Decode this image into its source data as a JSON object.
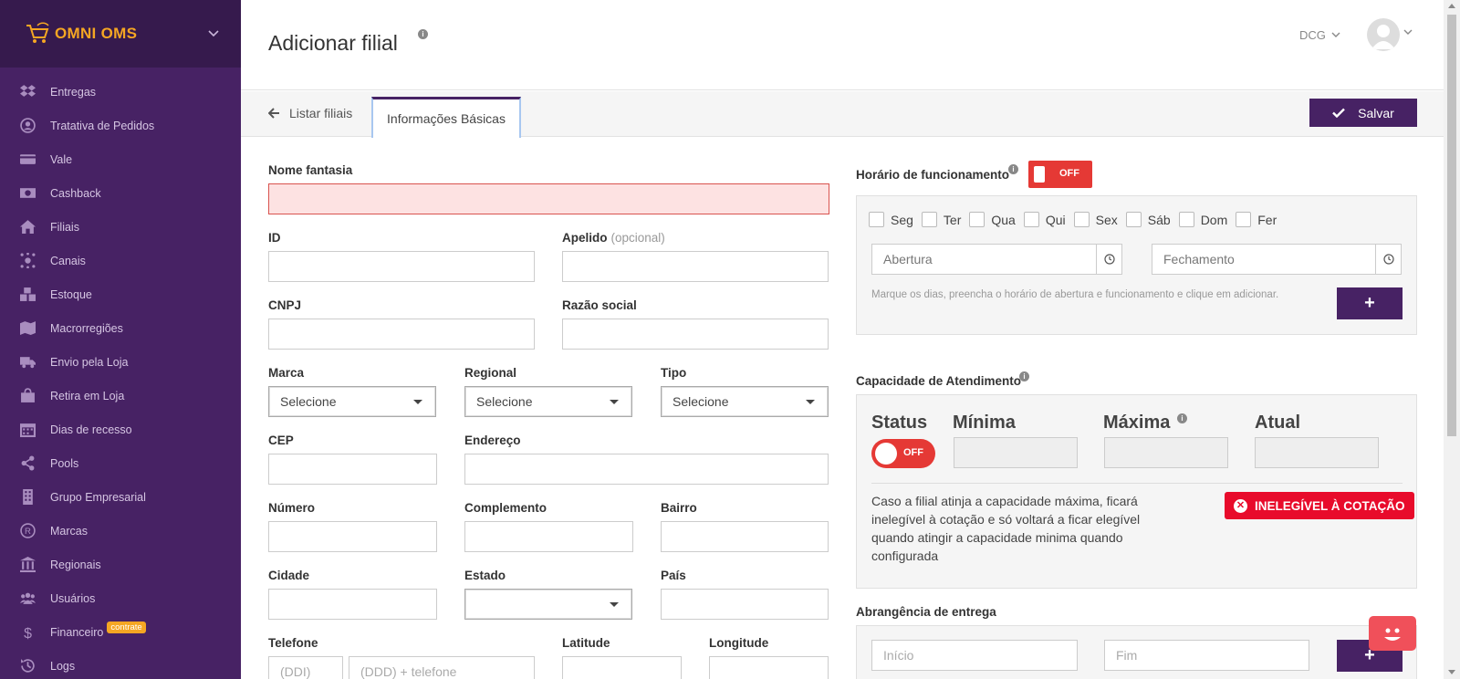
{
  "app": {
    "brand": "OMNI OMS",
    "brand_color": "#f5a623",
    "sidebar_color": "#472264",
    "accent": "#472264"
  },
  "sidebar": {
    "items": [
      {
        "label": "Entregas",
        "icon": "dropbox-icon"
      },
      {
        "label": "Tratativa de Pedidos",
        "icon": "user-circle-icon"
      },
      {
        "label": "Vale",
        "icon": "credit-card-icon"
      },
      {
        "label": "Cashback",
        "icon": "money-icon"
      },
      {
        "label": "Filiais",
        "icon": "home-icon"
      },
      {
        "label": "Canais",
        "icon": "channels-icon"
      },
      {
        "label": "Estoque",
        "icon": "cubes-icon"
      },
      {
        "label": "Macrorregiões",
        "icon": "map-icon"
      },
      {
        "label": "Envio pela Loja",
        "icon": "truck-icon"
      },
      {
        "label": "Retira em Loja",
        "icon": "shopping-bag-icon"
      },
      {
        "label": "Dias de recesso",
        "icon": "calendar-icon"
      },
      {
        "label": "Pools",
        "icon": "share-icon"
      },
      {
        "label": "Grupo Empresarial",
        "icon": "building-icon"
      },
      {
        "label": "Marcas",
        "icon": "registered-icon"
      },
      {
        "label": "Regionais",
        "icon": "bank-icon"
      },
      {
        "label": "Usuários",
        "icon": "users-icon"
      },
      {
        "label": "Financeiro",
        "icon": "dollar-icon",
        "badge": "contrate"
      },
      {
        "label": "Logs",
        "icon": "history-icon"
      }
    ]
  },
  "header": {
    "title": "Adicionar filial",
    "org": "DCG"
  },
  "tabs": {
    "back": "Listar filiais",
    "active": "Informações Básicas",
    "save": "Salvar"
  },
  "form": {
    "nome_fantasia": "Nome fantasia",
    "id": "ID",
    "apelido": "Apelido",
    "apelido_opt": "(opcional)",
    "cnpj": "CNPJ",
    "razao_social": "Razão social",
    "marca": "Marca",
    "regional": "Regional",
    "tipo": "Tipo",
    "select_placeholder": "Selecione",
    "cep": "CEP",
    "endereco": "Endereço",
    "numero": "Número",
    "complemento": "Complemento",
    "bairro": "Bairro",
    "cidade": "Cidade",
    "estado": "Estado",
    "pais": "País",
    "telefone": "Telefone",
    "ddi_placeholder": "(DDI)",
    "telefone_placeholder": "(DDD) + telefone",
    "latitude": "Latitude",
    "longitude": "Longitude"
  },
  "horario": {
    "label": "Horário de funcionamento",
    "toggle": "OFF",
    "days": [
      "Seg",
      "Ter",
      "Qua",
      "Qui",
      "Sex",
      "Sáb",
      "Dom",
      "Fer"
    ],
    "abertura": "Abertura",
    "fechamento": "Fechamento",
    "hint": "Marque os dias, preencha o horário de abertura e funcionamento e clique em adicionar.",
    "add": "+"
  },
  "capacidade": {
    "label": "Capacidade de Atendimento",
    "status": "Status",
    "minima": "Mínima",
    "maxima": "Máxima",
    "atual": "Atual",
    "toggle": "OFF",
    "text": "Caso a filial atinja a capacidade máxima, ficará inelegível à cotação e só voltará a ficar elegível quando atingir a capacidade minima quando configurada",
    "badge": "INELEGÍVEL À COTAÇÃO",
    "badge_color": "#e80b2b"
  },
  "abrangencia": {
    "label": "Abrangência de entrega",
    "inicio": "Início",
    "fim": "Fim",
    "add": "+"
  }
}
